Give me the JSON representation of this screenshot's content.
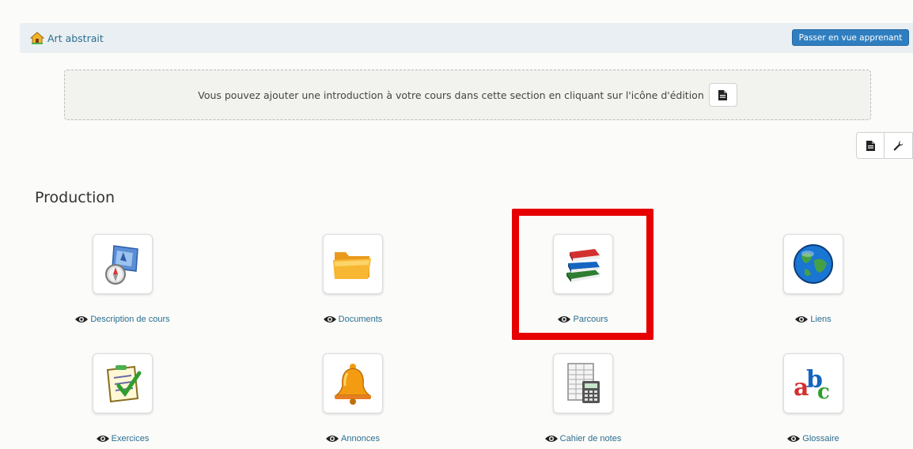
{
  "breadcrumb": {
    "course_title": "Art abstrait"
  },
  "header": {
    "student_view_label": "Passer en vue apprenant"
  },
  "intro": {
    "message": "Vous pouvez ajouter une introduction à votre cours dans cette section en cliquant sur l'icône d'édition"
  },
  "section": {
    "title": "Production"
  },
  "tools": [
    {
      "label": "Description de cours",
      "icon": "compass-map-icon"
    },
    {
      "label": "Documents",
      "icon": "folder-icon"
    },
    {
      "label": "Parcours",
      "icon": "books-icon"
    },
    {
      "label": "Liens",
      "icon": "globe-icon"
    },
    {
      "label": "Exercices",
      "icon": "checklist-icon"
    },
    {
      "label": "Annonces",
      "icon": "bell-icon"
    },
    {
      "label": "Cahier de notes",
      "icon": "gradebook-calculator-icon"
    },
    {
      "label": "Glossaire",
      "icon": "abc-letters-icon"
    }
  ],
  "colors": {
    "accent": "#2f7fc0",
    "link": "#2b6e8f",
    "highlight": "#e60000"
  }
}
